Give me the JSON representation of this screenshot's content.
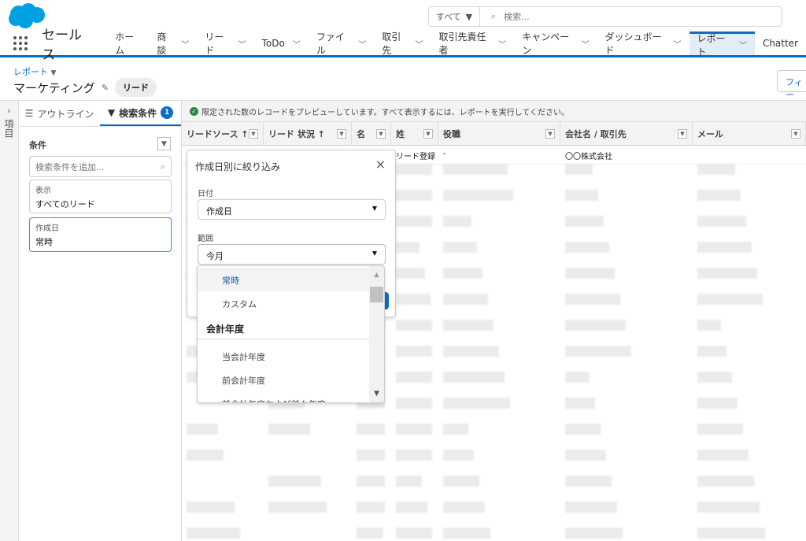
{
  "header": {
    "search_scope": "すべて",
    "search_placeholder": "検索..."
  },
  "nav": {
    "app_name": "セールス",
    "tabs": [
      {
        "label": "ホーム",
        "chevron": false
      },
      {
        "label": "商談",
        "chevron": true
      },
      {
        "label": "リード",
        "chevron": true
      },
      {
        "label": "ToDo",
        "chevron": true
      },
      {
        "label": "ファイル",
        "chevron": true
      },
      {
        "label": "取引先",
        "chevron": true
      },
      {
        "label": "取引先責任者",
        "chevron": true
      },
      {
        "label": "キャンペーン",
        "chevron": true
      },
      {
        "label": "ダッシュボード",
        "chevron": true
      },
      {
        "label": "レポート",
        "chevron": true,
        "active": true
      },
      {
        "label": "Chatter",
        "chevron": false
      }
    ]
  },
  "page": {
    "breadcrumb": "レポート",
    "title": "マーケティング",
    "type_pill": "リード",
    "filter_button": "フィー"
  },
  "rail": {
    "label": "項目"
  },
  "filter_panel": {
    "tab_outline": "アウトライン",
    "tab_filters": "検索条件",
    "filter_count": "1",
    "section": "条件",
    "add_placeholder": "検索条件を追加...",
    "filters": [
      {
        "label": "表示",
        "value": "すべてのリード"
      },
      {
        "label": "作成日",
        "value": "常時"
      }
    ]
  },
  "info": "限定された数のレコードをプレビューしています。すべて表示するには、レポートを実行してください。",
  "table": {
    "columns": [
      "リードソース ↑",
      "リード 状況 ↑",
      "名",
      "姓",
      "役職",
      "会社名 / 取引先",
      "メール"
    ],
    "first_row": [
      "",
      "",
      "",
      "リード登録",
      "-",
      "〇〇株式会社",
      ""
    ]
  },
  "popover": {
    "title": "作成日別に絞り込み",
    "date_label": "日付",
    "date_value": "作成日",
    "range_label": "範囲",
    "range_value": "今月"
  },
  "range_options": [
    {
      "label": "常時",
      "type": "highlighted"
    },
    {
      "label": "カスタム",
      "type": "option"
    },
    {
      "label": "会計年度",
      "type": "group"
    },
    {
      "label": "当会計年度",
      "type": "option"
    },
    {
      "label": "前会計年度",
      "type": "option"
    },
    {
      "label": "前会計年度および前々年度",
      "type": "option"
    }
  ],
  "colors": {
    "brand": "#0b6bcb",
    "logo": "#00a1e0",
    "success": "#2e844a"
  }
}
